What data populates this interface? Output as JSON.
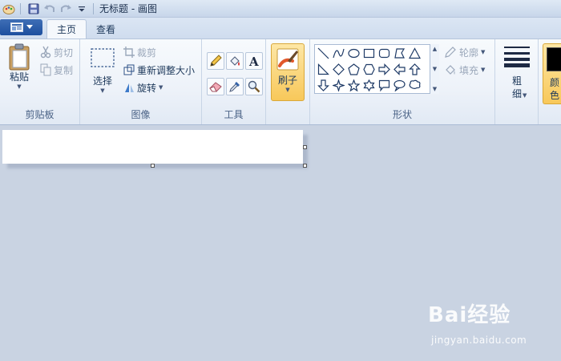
{
  "window": {
    "title": "无标题 - 画图"
  },
  "tabs": [
    {
      "label": "主页",
      "active": true
    },
    {
      "label": "查看",
      "active": false
    }
  ],
  "clipboard": {
    "group_label": "剪贴板",
    "paste_label": "粘贴",
    "cut_label": "剪切",
    "copy_label": "复制"
  },
  "image": {
    "group_label": "图像",
    "select_label": "选择",
    "crop_label": "裁剪",
    "resize_label": "重新调整大小",
    "rotate_label": "旋转"
  },
  "tools": {
    "group_label": "工具"
  },
  "brushes": {
    "label": "刷子"
  },
  "shapes": {
    "group_label": "形状",
    "outline_label": "轮廓",
    "fill_label": "填充"
  },
  "size": {
    "label_line1": "粗",
    "label_line2": "细"
  },
  "colors": {
    "color1_label": "颜色",
    "color1_value": "#000000",
    "accent": "#f8c85a"
  },
  "watermark": {
    "main": "Bai经验",
    "sub": "jingyan.baidu.com"
  }
}
